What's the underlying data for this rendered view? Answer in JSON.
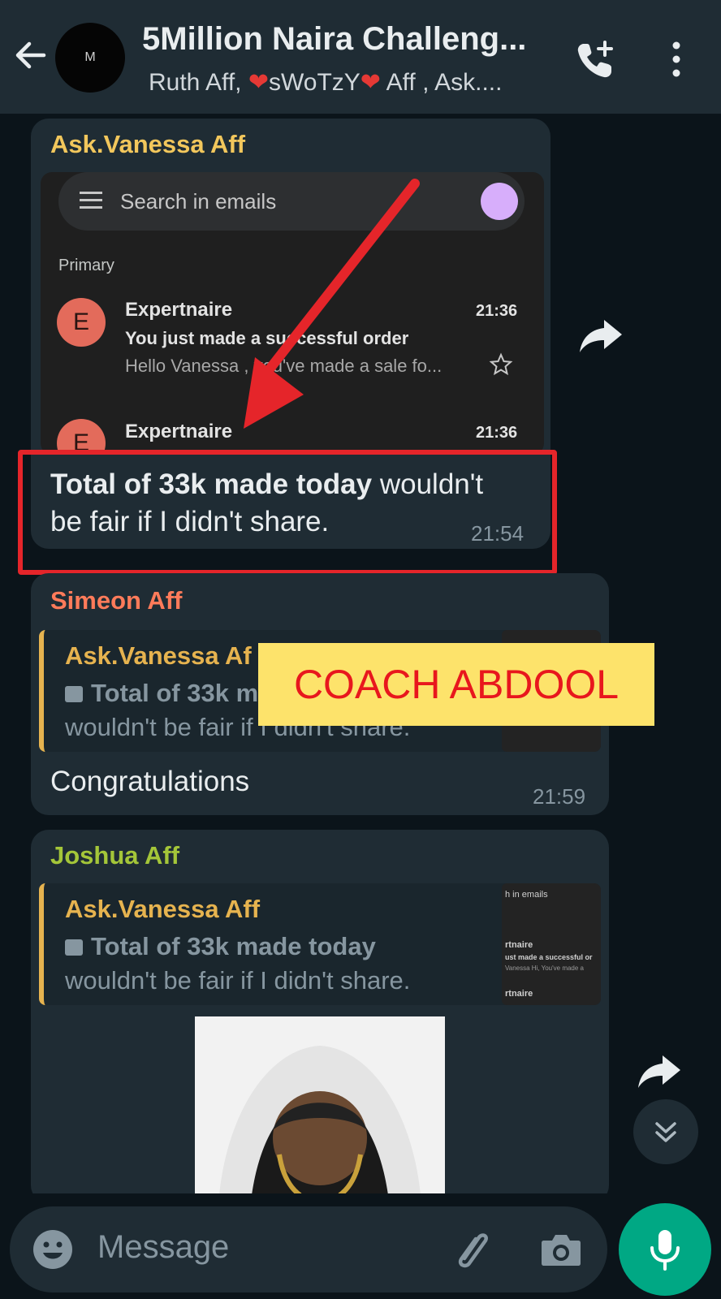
{
  "header": {
    "avatar_letter": "M",
    "title": "5Million Naira Challeng...",
    "subtitle_part1": "Ruth Aff, ",
    "subtitle_part2": "sWoTzY",
    "subtitle_part3": " Aff , Ask....",
    "heart_glyph": "❤"
  },
  "messages": [
    {
      "sender": "Ask.Vanessa Aff",
      "sender_color": "#f2c75c",
      "email_screenshot": {
        "search_placeholder": "Search in emails",
        "section": "Primary",
        "emails": [
          {
            "initial": "E",
            "from": "Expertnaire",
            "time": "21:36",
            "subject": "You just made a successful order",
            "preview": "Hello Vanessa , you've made a sale fo..."
          },
          {
            "initial": "E",
            "from": "Expertnaire",
            "time": "21:36"
          }
        ]
      },
      "text_bold": "Total of 33k made today",
      "text_regular": " wouldn't",
      "text_line2": "be fair if I didn't share.",
      "time": "21:54"
    },
    {
      "sender": "Simeon Aff",
      "sender_color": "#ff7b5a",
      "quote": {
        "name": "Ask.Vanessa Af",
        "line1": "Total of 33k m",
        "line2": "wouldn't be fair if I didn't share."
      },
      "text": "Congratulations",
      "time": "21:59"
    },
    {
      "sender": "Joshua Aff",
      "sender_color": "#a4c639",
      "quote": {
        "name": "Ask.Vanessa Aff",
        "line1": "Total of 33k made today",
        "line2": "wouldn't be fair if I didn't share.",
        "thumb_lines": [
          "h in emails",
          "rtnaire",
          "ust made a successful or",
          "Vanessa Hi, You've made a",
          "rtnaire"
        ]
      }
    }
  ],
  "watermark": "COACH ABDOOL",
  "input": {
    "placeholder": "Message"
  },
  "colors": {
    "header_bg": "#1f2c34",
    "chat_bg": "#0b141a",
    "bubble_bg": "#1f2c34",
    "accent_green": "#00a884",
    "highlight_red": "#e5252a"
  }
}
